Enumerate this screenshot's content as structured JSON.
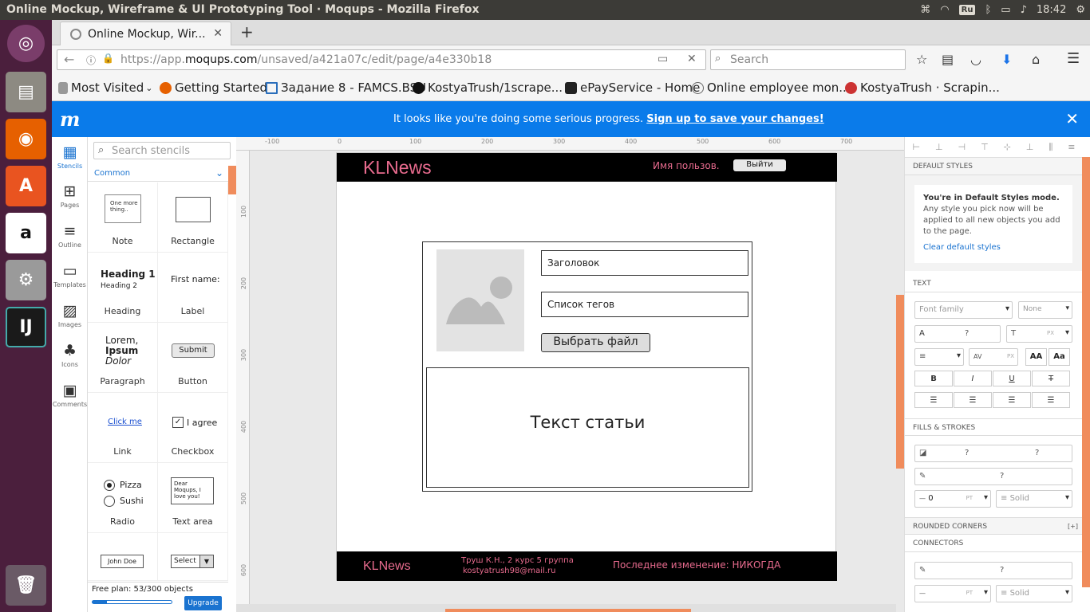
{
  "os": {
    "window_title": "Online Mockup, Wireframe & UI Prototyping Tool · Moqups - Mozilla Firefox",
    "keyboard_layout": "Ru",
    "time": "18:42"
  },
  "browser": {
    "tab_title": "Online Mockup, Wir...",
    "url_prefix": "https://app.",
    "url_domain": "moqups.com",
    "url_path": "/unsaved/a421a07c/edit/page/a4e330b18",
    "search_placeholder": "Search",
    "bookmarks": [
      "Most Visited",
      "Getting Started",
      "Задание 8 - FAMCS.BSU",
      "KostyaTrush/1scrape...",
      "ePayService - Home",
      "Online employee mon...",
      "KostyaTrush · Scrapin..."
    ]
  },
  "banner": {
    "logo": "m",
    "message": "It looks like you're doing some serious progress.",
    "link": "Sign up to save your changes!"
  },
  "leftnav": [
    "Stencils",
    "Pages",
    "Outline",
    "Templates",
    "Images",
    "Icons",
    "Comments"
  ],
  "stencils": {
    "search_placeholder": "Search stencils",
    "category": "Common",
    "items": [
      {
        "label": "Note",
        "preview": "One more thing.."
      },
      {
        "label": "Rectangle"
      },
      {
        "label": "Heading",
        "preview": "Heading 1",
        "preview2": "Heading 2"
      },
      {
        "label": "Label",
        "preview": "First name:"
      },
      {
        "label": "Paragraph",
        "preview": "Lorem,",
        "preview2": "Ipsum",
        "preview3": "Dolor"
      },
      {
        "label": "Button",
        "preview": "Submit"
      },
      {
        "label": "Link",
        "preview": "Click me"
      },
      {
        "label": "Checkbox",
        "preview": "I agree"
      },
      {
        "label": "Radio",
        "preview": "Pizza",
        "preview2": "Sushi"
      },
      {
        "label": "Text area",
        "preview": "Dear Moqups, I love you!"
      },
      {
        "label": "",
        "preview": "John Doe"
      },
      {
        "label": "",
        "preview": "Select"
      }
    ],
    "free_plan": "Free plan: 53/300 objects",
    "upgrade": "Upgrade",
    "plan_usage_fraction": 0.177
  },
  "ruler": {
    "h": [
      "-100",
      "0",
      "100",
      "200",
      "300",
      "400",
      "500",
      "600",
      "700"
    ],
    "v": [
      "100",
      "200",
      "300",
      "400",
      "500",
      "600"
    ]
  },
  "mockup": {
    "header_logo": "KLNews",
    "user_name": "Имя пользов.",
    "logout": "Выйти",
    "title_field": "Заголовок",
    "tags_field": "Список тегов",
    "choose_file": "Выбрать файл",
    "article_text": "Текст статьи",
    "footer_logo": "KLNews",
    "footer_author": "Труш К.Н., 2 курс 5 группа",
    "footer_email": "kostyatrush98@mail.ru",
    "footer_modified": "Последнее изменение: НИКОГДА",
    "accent": "#e86b8e"
  },
  "rightpanel": {
    "default_styles": "DEFAULT STYLES",
    "mode_title": "You're in Default Styles mode.",
    "mode_desc": "Any style you pick now will be applied to all new objects you add to the page.",
    "clear": "Clear default styles",
    "text_hdr": "TEXT",
    "font_family": "Font family",
    "font_weight": "None",
    "q": "?",
    "px": "PX",
    "aa1": "AA",
    "aa2": "Aa",
    "b": "B",
    "i": "I",
    "u": "U",
    "s": "T",
    "fills_hdr": "FILLS & STROKES",
    "stroke_val": "0",
    "pt": "PT",
    "solid": "Solid",
    "rounded_hdr": "ROUNDED CORNERS",
    "rounded_toggle": "[+]",
    "connectors_hdr": "CONNECTORS"
  }
}
